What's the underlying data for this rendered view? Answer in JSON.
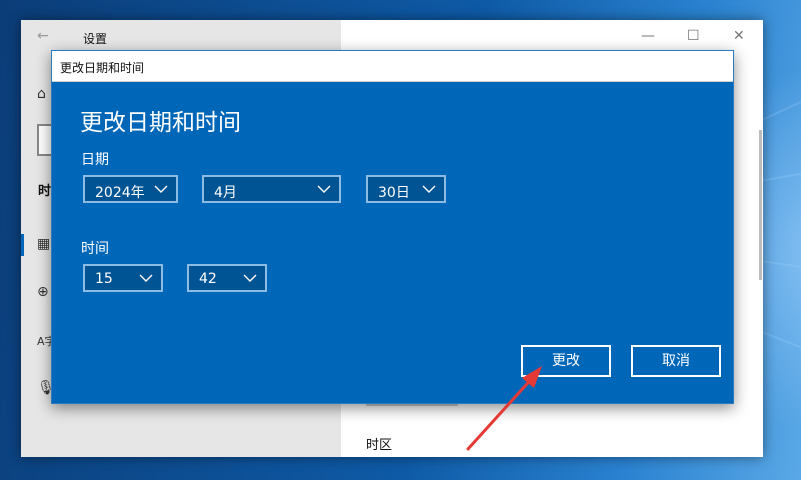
{
  "settings": {
    "title": "设置",
    "side_heading": "时",
    "timezone_label": "时区"
  },
  "dialog": {
    "titlebar": "更改日期和时间",
    "heading": "更改日期和时间",
    "date_label": "日期",
    "year": "2024年",
    "month": "4月",
    "day": "30日",
    "time_label": "时间",
    "hour": "15",
    "minute": "42",
    "change_button": "更改",
    "cancel_button": "取消"
  },
  "colors": {
    "dialog_bg": "#0067b8",
    "annotation_arrow": "#e53935"
  }
}
